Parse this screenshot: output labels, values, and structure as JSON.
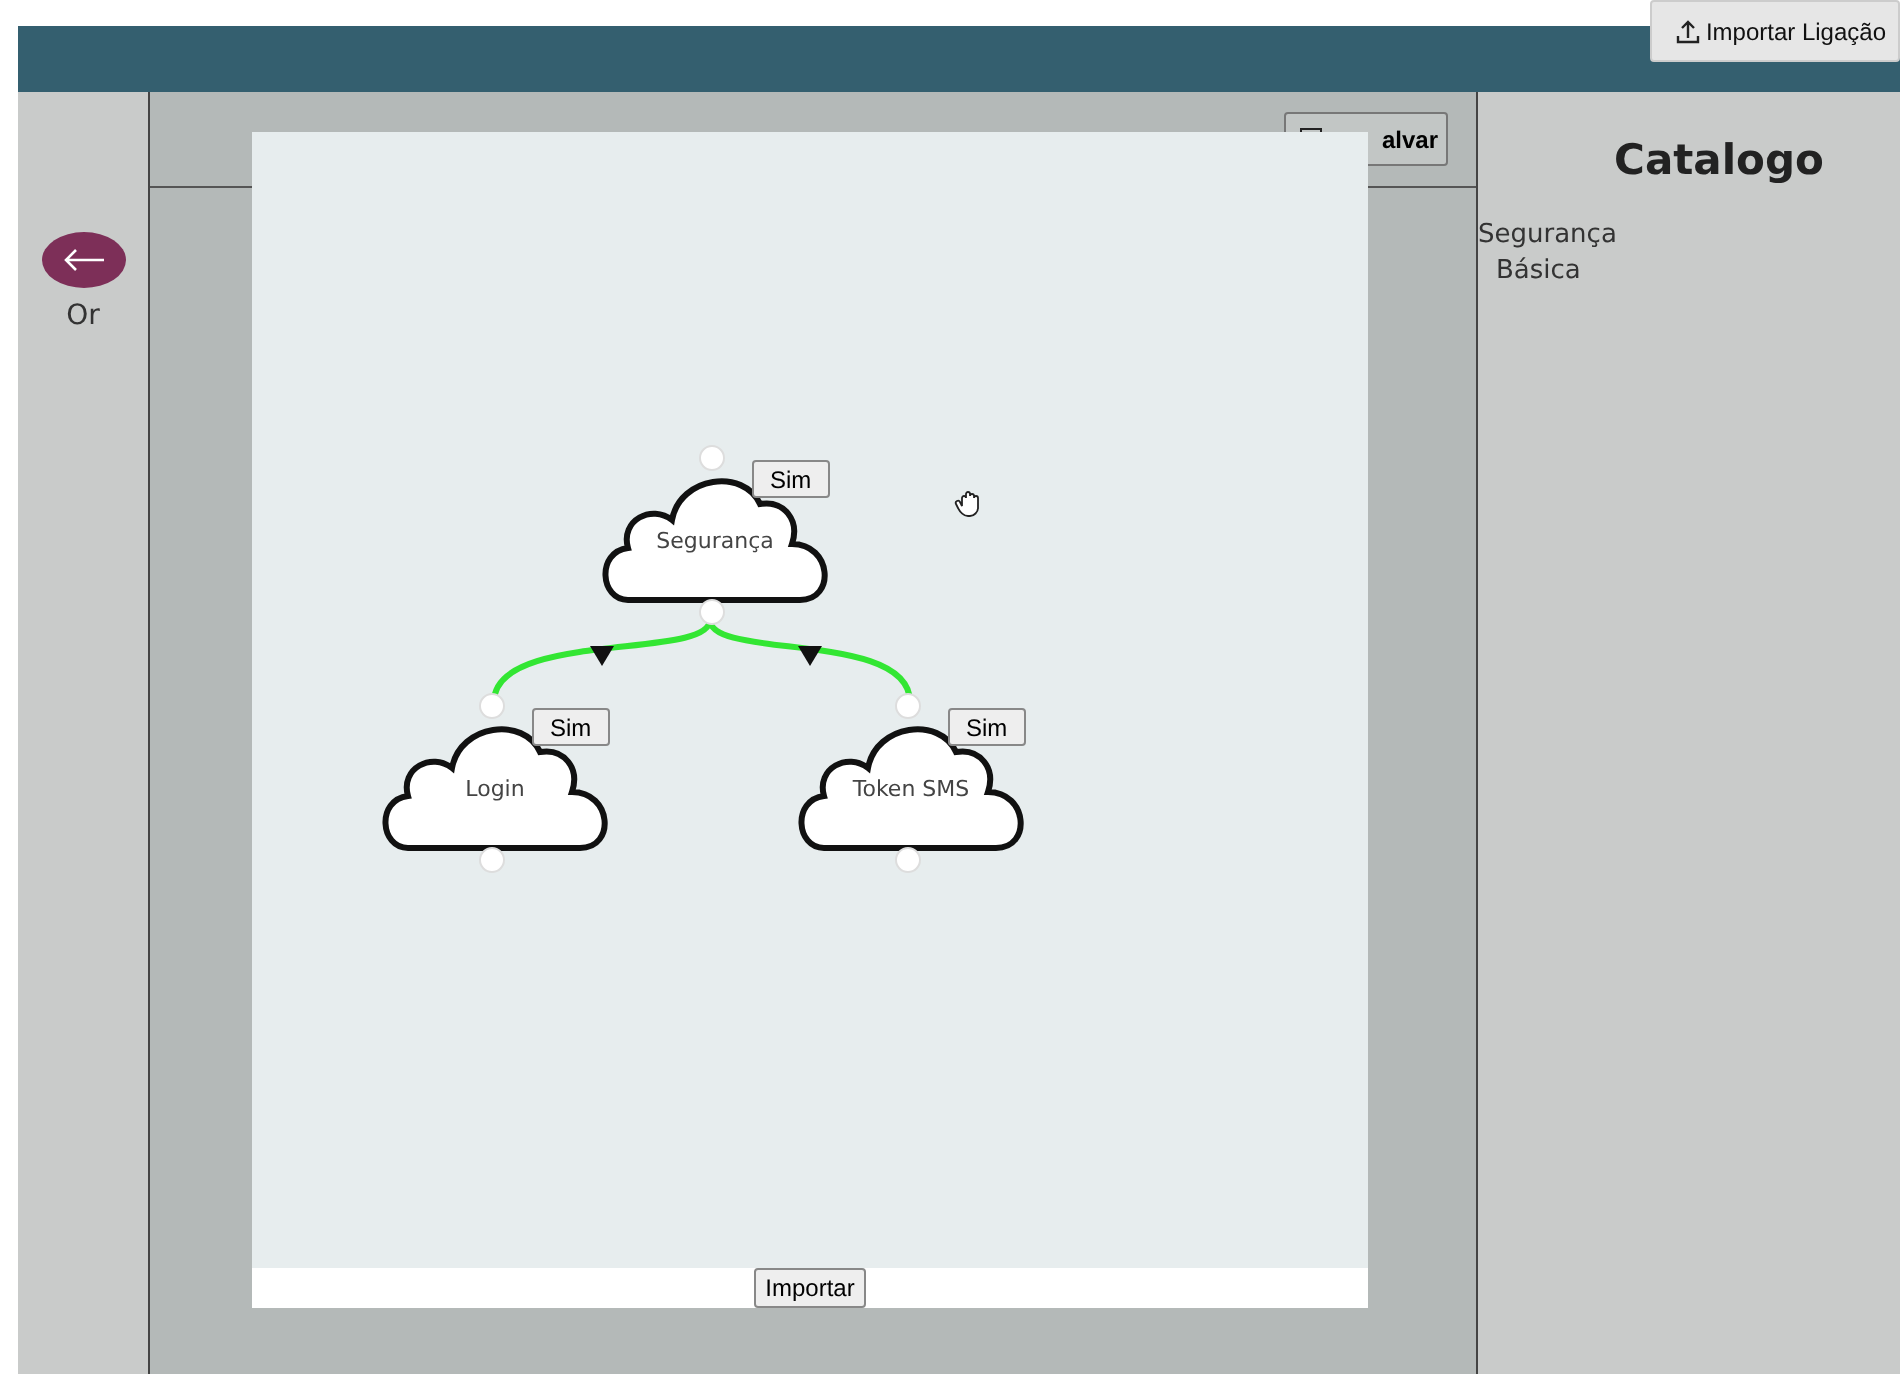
{
  "header": {
    "import_button": "Importar Ligação"
  },
  "sidebar": {
    "back_label": "Or"
  },
  "toolbar": {
    "save_button": "alvar"
  },
  "catalog": {
    "title": "Catalogo",
    "items": [
      {
        "label": "Segurança",
        "children": [
          {
            "label": "Básica"
          }
        ]
      }
    ]
  },
  "modal": {
    "root": {
      "label": "Segurança",
      "badge": "Sim",
      "children": [
        {
          "label": "Login",
          "badge": "Sim"
        },
        {
          "label": "Token SMS",
          "badge": "Sim"
        }
      ]
    },
    "import_button": "Importar"
  }
}
